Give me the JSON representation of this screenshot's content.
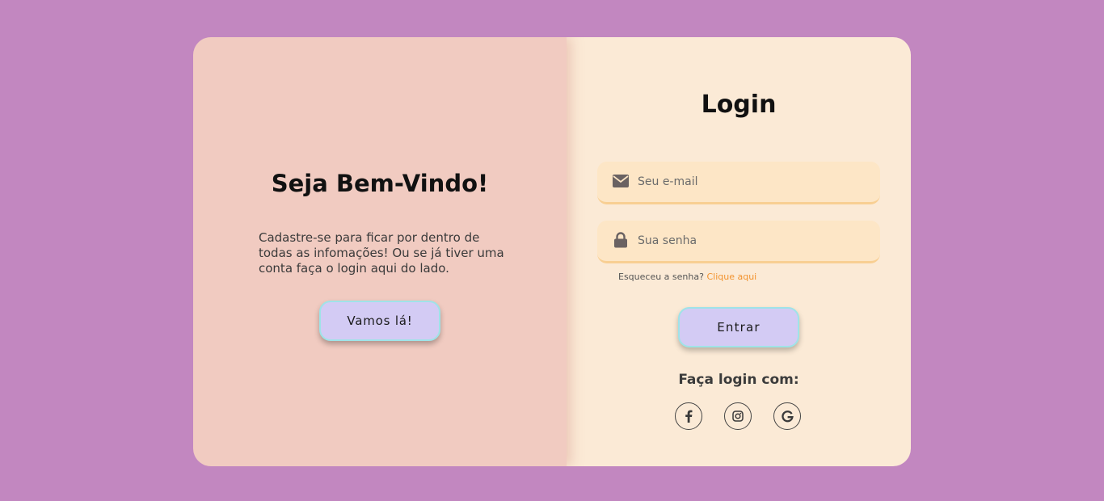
{
  "welcome": {
    "title": "Seja Bem-Vindo!",
    "text": "Cadastre-se para ficar por dentro de todas as infomações! Ou se já tiver uma conta faça o login aqui do lado.",
    "button_label": "Vamos lá!"
  },
  "login": {
    "title": "Login",
    "email_placeholder": "Seu e-mail",
    "password_placeholder": "Sua senha",
    "forgot_text": "Esqueceu a senha?",
    "forgot_link": "Clique aqui",
    "submit_label": "Entrar",
    "social_title": "Faça login com:",
    "social_icons": [
      "facebook-icon",
      "instagram-icon",
      "google-icon"
    ]
  },
  "colors": {
    "background": "#c287c0",
    "left_panel": "#f1cbc1",
    "right_panel": "#fbead6",
    "input_bg": "#fde6c6",
    "button_bg": "#d3cbf4",
    "button_border": "#9fe3e8",
    "link": "#f2932f"
  }
}
